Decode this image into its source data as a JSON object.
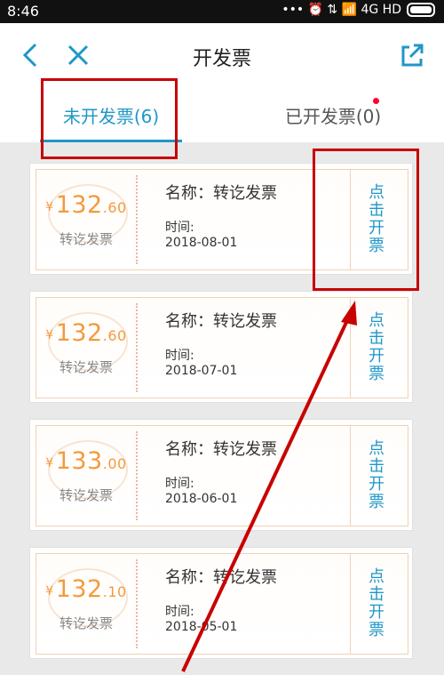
{
  "status": {
    "time": "8:46",
    "indicators": "••• ⏰ ⇅ 📶 4G HD"
  },
  "header": {
    "title": "开发票"
  },
  "tabs": [
    {
      "label": "未开发票(6)"
    },
    {
      "label": "已开发票(0)"
    }
  ],
  "invoices": [
    {
      "amount_int": "132",
      "amount_dec": ".60",
      "currency": "¥",
      "type": "转讫发票",
      "name": "名称：转讫发票",
      "time_label": "时间:",
      "date": "2018-08-01",
      "button": "点\n击\n开\n票"
    },
    {
      "amount_int": "132",
      "amount_dec": ".60",
      "currency": "¥",
      "type": "转讫发票",
      "name": "名称：转讫发票",
      "time_label": "时间:",
      "date": "2018-07-01",
      "button": "点\n击\n开\n票"
    },
    {
      "amount_int": "133",
      "amount_dec": ".00",
      "currency": "¥",
      "type": "转讫发票",
      "name": "名称：转讫发票",
      "time_label": "时间:",
      "date": "2018-06-01",
      "button": "点\n击\n开\n票"
    },
    {
      "amount_int": "132",
      "amount_dec": ".10",
      "currency": "¥",
      "type": "转讫发票",
      "name": "名称：转讫发票",
      "time_label": "时间:",
      "date": "2018-05-01",
      "button": "点\n击\n开\n票"
    }
  ],
  "colors": {
    "accent": "#1f97c7",
    "amount": "#f39a3d",
    "annotation": "#c80000"
  }
}
